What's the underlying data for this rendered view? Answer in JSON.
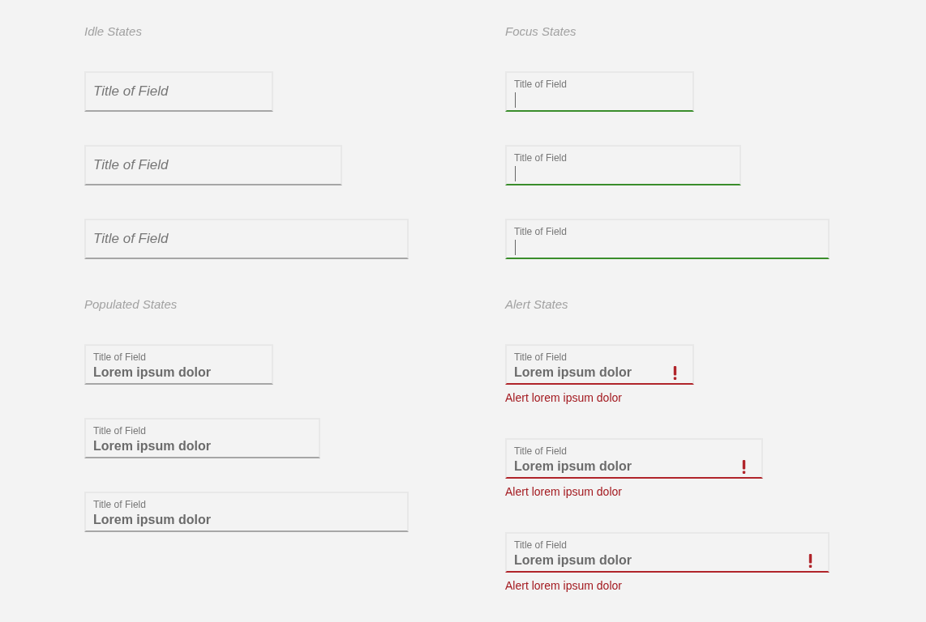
{
  "sections": [
    {
      "title": "Idle States",
      "fields": [
        {
          "kind": "idle",
          "placeholder": "Title of Field"
        },
        {
          "kind": "idle",
          "placeholder": "Title of Field"
        },
        {
          "kind": "idle",
          "placeholder": "Title of Field"
        }
      ]
    },
    {
      "title": "Focus States",
      "fields": [
        {
          "kind": "focus",
          "label": "Title of Field"
        },
        {
          "kind": "focus",
          "label": "Title of Field"
        },
        {
          "kind": "focus",
          "label": "Title of Field"
        }
      ]
    },
    {
      "title": "Populated States",
      "fields": [
        {
          "kind": "populated",
          "label": "Title of Field",
          "value": "Lorem ipsum dolor"
        },
        {
          "kind": "populated",
          "label": "Title of Field",
          "value": "Lorem ipsum dolor"
        },
        {
          "kind": "populated",
          "label": "Title of Field",
          "value": "Lorem ipsum dolor"
        }
      ]
    },
    {
      "title": "Alert States",
      "fields": [
        {
          "kind": "alert",
          "label": "Title of Field",
          "value": "Lorem ipsum dolor",
          "message": "Alert lorem ipsum dolor"
        },
        {
          "kind": "alert",
          "label": "Title of Field",
          "value": "Lorem ipsum dolor",
          "message": "Alert lorem ipsum dolor"
        },
        {
          "kind": "alert",
          "label": "Title of Field",
          "value": "Lorem ipsum dolor",
          "message": "Alert lorem ipsum dolor"
        }
      ]
    }
  ]
}
